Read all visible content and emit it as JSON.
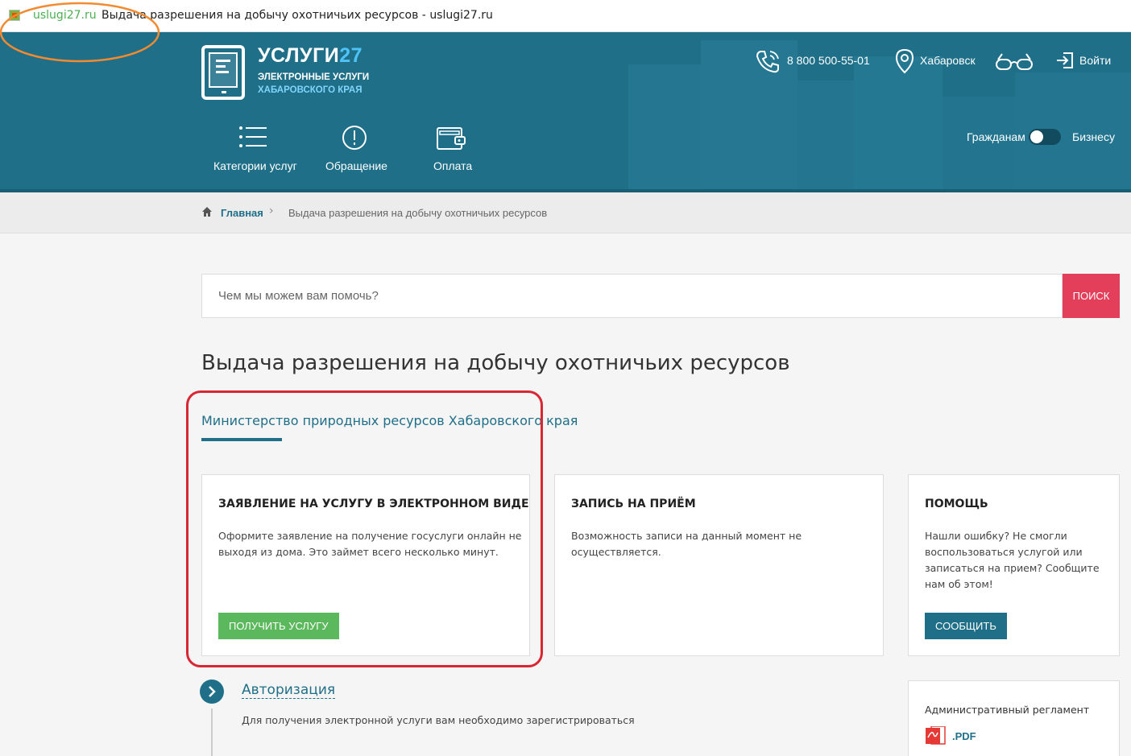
{
  "browser": {
    "url": "uslugi27.ru",
    "tab_title": "Выдача разрешения на добычу охотничьих ресурсов - uslugi27.ru"
  },
  "header": {
    "logo_name": "УСЛУГИ",
    "logo_num": "27",
    "logo_sub1": "ЭЛЕКТРОННЫЕ УСЛУГИ",
    "logo_sub2": "ХАБАРОВСКОГО КРАЯ",
    "phone": "8 800 500-55-01",
    "city": "Хабаровск",
    "login": "Войти",
    "accent_color": "#1f6f89"
  },
  "nav": [
    {
      "label": "Категории услуг",
      "icon": "list-icon"
    },
    {
      "label": "Обращение",
      "icon": "exclamation-circle-icon"
    },
    {
      "label": "Оплата",
      "icon": "wallet-icon"
    }
  ],
  "audience_toggle": {
    "left_label": "Гражданам",
    "right_label": "Бизнесу"
  },
  "breadcrumb": {
    "home": "Главная",
    "current": "Выдача разрешения на добычу охотничьих ресурсов"
  },
  "search": {
    "placeholder": "Чем мы можем вам помочь?",
    "button": "ПОИСК",
    "button_color": "#e43f5a"
  },
  "main": {
    "title": "Выдача разрешения на добычу охотничьих ресурсов",
    "ministry": "Министерство природных ресурсов Хабаровского края"
  },
  "cards": [
    {
      "title": "ЗАЯВЛЕНИЕ НА УСЛУГУ В ЭЛЕКТРОННОМ ВИДЕ",
      "text_line1": "Оформите заявление на получение госуслуги онлайн не",
      "text_line2": "выходя из дома. Это займет всего несколько минут.",
      "button": "ПОЛУЧИТЬ УСЛУГУ",
      "button_color": "#5cb85c"
    },
    {
      "title": "ЗАПИСЬ НА ПРИЁМ",
      "text_line1": "Возможность записи на данный момент не осуществляется."
    },
    {
      "title": "ПОМОЩЬ",
      "text_line1": "Нашли ошибку? Не смогли",
      "text_line2": "воспользоваться услугой или",
      "text_line3": "записаться на прием? Сообщите",
      "text_line4": "нам об этом!",
      "button": "СООБЩИТЬ",
      "button_color": "#1f6f89"
    }
  ],
  "auth_step": {
    "title": "Авторизация",
    "text": "Для получения электронной услуги вам необходимо зарегистрироваться"
  },
  "regulation": {
    "title": "Административный регламент",
    "file_label": ".PDF"
  }
}
